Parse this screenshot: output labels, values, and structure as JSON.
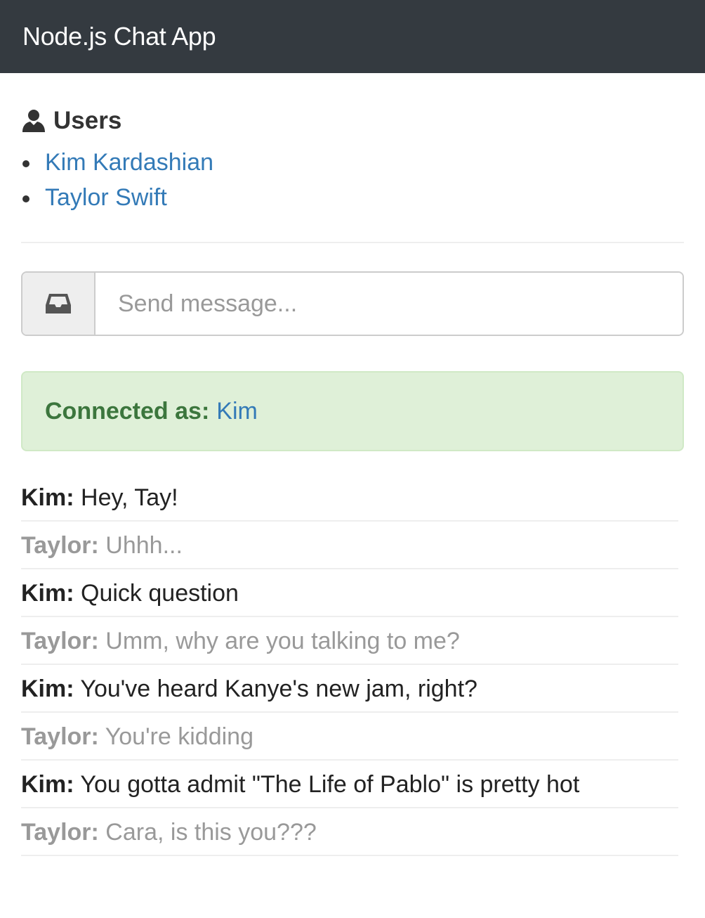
{
  "navbar": {
    "brand": "Node.js Chat App"
  },
  "users": {
    "title": "Users",
    "icon": "user-icon",
    "items": [
      {
        "label": "Kim Kardashian"
      },
      {
        "label": "Taylor Swift"
      }
    ]
  },
  "composer": {
    "icon": "inbox-icon",
    "placeholder": "Send message...",
    "value": ""
  },
  "status": {
    "label": "Connected as:",
    "user": "Kim"
  },
  "messages": [
    {
      "author": "Kim:",
      "text": "Hey, Tay!"
    },
    {
      "author": "Taylor:",
      "text": "Uhhh..."
    },
    {
      "author": "Kim:",
      "text": "Quick question"
    },
    {
      "author": "Taylor:",
      "text": "Umm, why are you talking to me?"
    },
    {
      "author": "Kim:",
      "text": "You've heard Kanye's new jam, right?"
    },
    {
      "author": "Taylor:",
      "text": "You're kidding"
    },
    {
      "author": "Kim:",
      "text": "You gotta admit \"The Life of Pablo\" is pretty hot"
    },
    {
      "author": "Taylor:",
      "text": "Cara, is this you???"
    }
  ],
  "colors": {
    "navbar": "#343a40",
    "link": "#337ab7",
    "alert_bg": "#dff0d8",
    "alert_text": "#3c763d",
    "muted": "#999999"
  }
}
